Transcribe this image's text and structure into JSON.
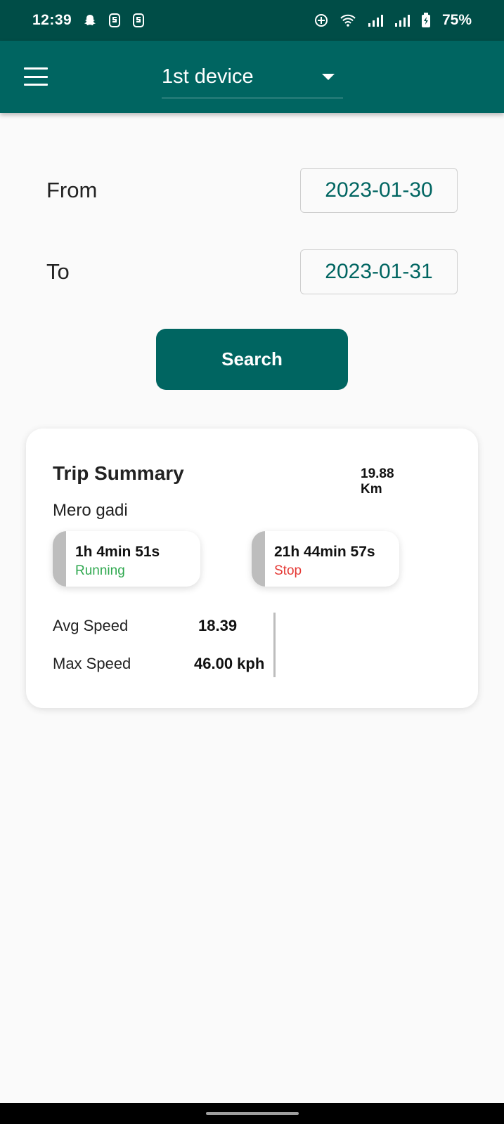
{
  "status_bar": {
    "time": "12:39",
    "battery_percent": "75%",
    "icons": [
      "snapchat-icon",
      "notification-s-icon",
      "notification-s-icon",
      "hotspot-icon",
      "wifi-icon",
      "signal-icon",
      "signal-icon",
      "battery-charging-icon"
    ]
  },
  "app_bar": {
    "device_selected": "1st device"
  },
  "filters": {
    "from_label": "From",
    "from_value": "2023-01-30",
    "to_label": "To",
    "to_value": "2023-01-31",
    "search_label": "Search"
  },
  "trip_summary": {
    "title": "Trip Summary",
    "distance_value": "19.88",
    "distance_unit": "Km",
    "vehicle_name": "Mero gadi",
    "running_duration": "1h 4min 51s",
    "running_label": "Running",
    "stop_duration": "21h 44min 57s",
    "stop_label": "Stop",
    "avg_speed_label": "Avg Speed",
    "avg_speed_value": "18.39",
    "max_speed_label": "Max Speed",
    "max_speed_value": "46.00 kph"
  },
  "colors": {
    "status_bar": "#004d47",
    "primary": "#006561",
    "running": "#2fa84f",
    "stop": "#e53935"
  }
}
